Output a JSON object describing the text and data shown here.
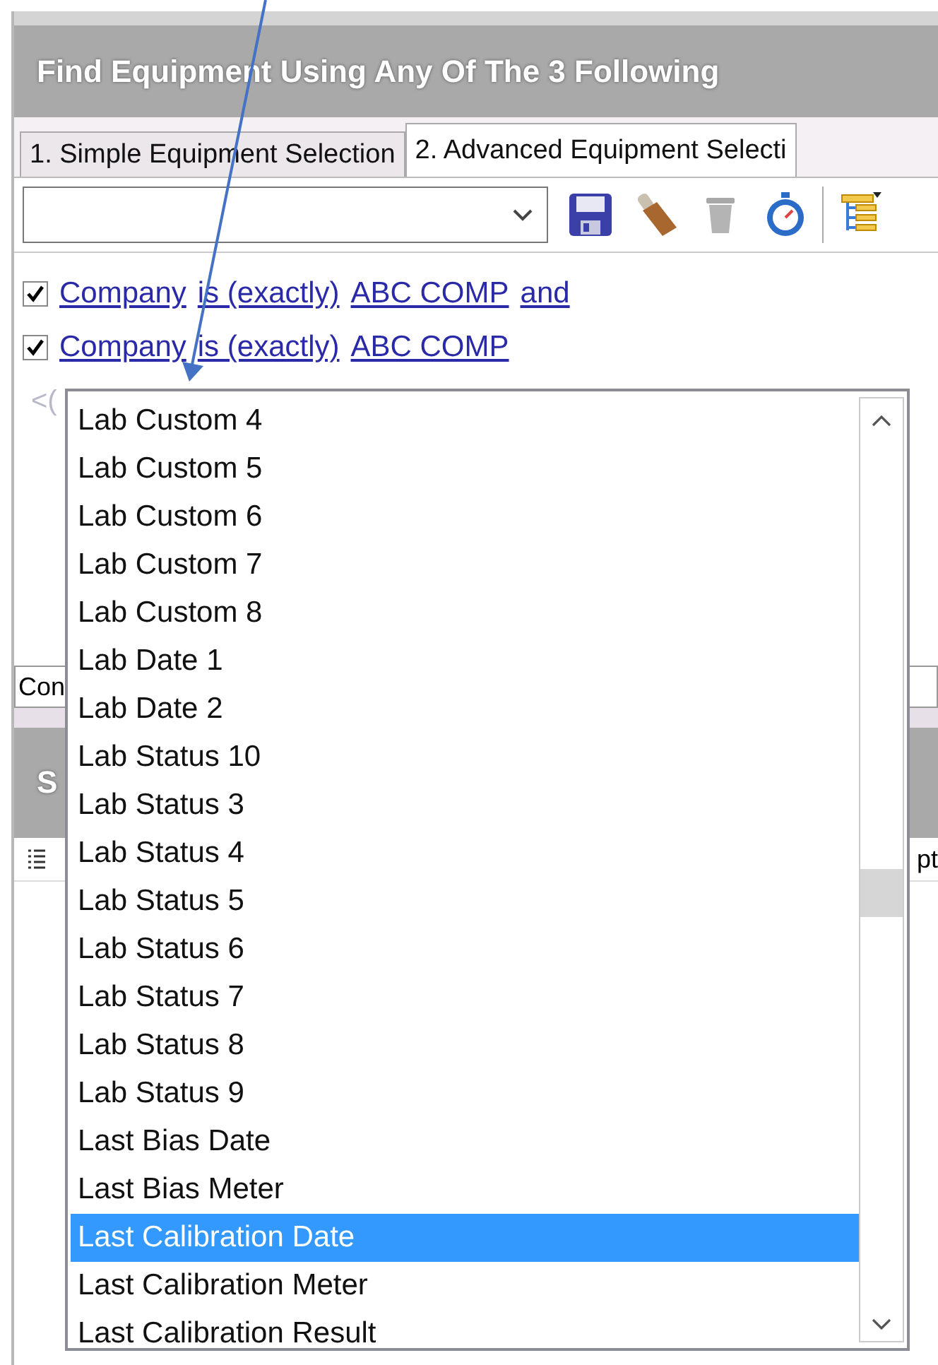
{
  "header": {
    "title": "Find Equipment Using Any Of The 3 Following"
  },
  "tabs": [
    {
      "label": "1. Simple Equipment Selection",
      "selected": false
    },
    {
      "label": "2. Advanced Equipment Selecti",
      "selected": true
    }
  ],
  "toolbar": {
    "buttons": [
      {
        "kind": "save",
        "disabled": false
      },
      {
        "kind": "sweep",
        "disabled": false
      },
      {
        "kind": "delete",
        "disabled": true
      },
      {
        "kind": "timer",
        "disabled": false
      },
      {
        "kind": "tree",
        "disabled": false
      }
    ]
  },
  "conditions": [
    {
      "checked": true,
      "parts": [
        "Company",
        "is (exactly)",
        "ABC COMP",
        "and"
      ]
    },
    {
      "checked": true,
      "parts": [
        "Company",
        "is (exactly)",
        "ABC COMP"
      ]
    }
  ],
  "condition_hint": "<(",
  "filter_field": {
    "value": "Con"
  },
  "results": {
    "title": "S",
    "column_tail": "pt"
  },
  "dropdown_list": {
    "items": [
      {
        "label": "Lab Custom 4",
        "selected": false
      },
      {
        "label": "Lab Custom 5",
        "selected": false
      },
      {
        "label": "Lab Custom 6",
        "selected": false
      },
      {
        "label": "Lab Custom 7",
        "selected": false
      },
      {
        "label": "Lab Custom 8",
        "selected": false
      },
      {
        "label": "Lab Date 1",
        "selected": false
      },
      {
        "label": "Lab Date 2",
        "selected": false
      },
      {
        "label": "Lab Status 10",
        "selected": false
      },
      {
        "label": "Lab Status 3",
        "selected": false
      },
      {
        "label": "Lab Status 4",
        "selected": false
      },
      {
        "label": "Lab Status 5",
        "selected": false
      },
      {
        "label": "Lab Status 6",
        "selected": false
      },
      {
        "label": "Lab Status 7",
        "selected": false
      },
      {
        "label": "Lab Status 8",
        "selected": false
      },
      {
        "label": "Lab Status 9",
        "selected": false
      },
      {
        "label": "Last Bias Date",
        "selected": false
      },
      {
        "label": "Last Bias Meter",
        "selected": false
      },
      {
        "label": "Last Calibration Date",
        "selected": true
      },
      {
        "label": "Last Calibration Meter",
        "selected": false
      },
      {
        "label": "Last Calibration Result",
        "selected": false
      }
    ]
  }
}
